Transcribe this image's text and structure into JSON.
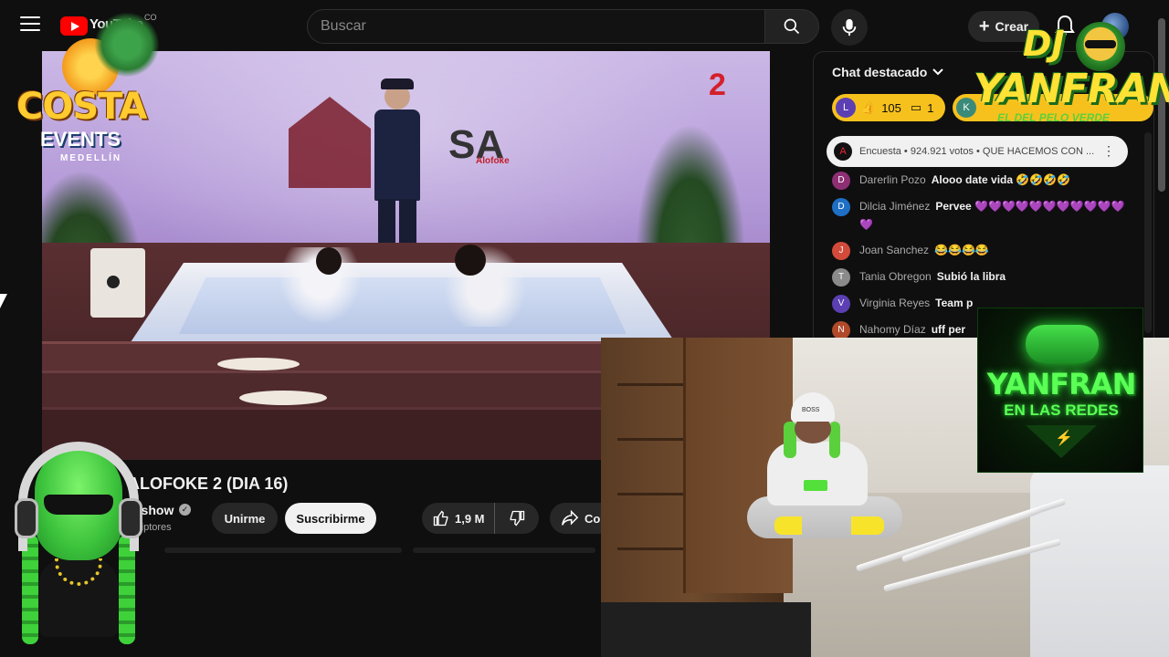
{
  "header": {
    "logo_text": "YouTube",
    "country_code": "CO",
    "search_placeholder": "Buscar",
    "create_label": "Crear"
  },
  "video": {
    "overlay_number": "2",
    "wall_logo_text": "SA",
    "wall_logo_brand": "Alofoke",
    "title": "ALOFOKE 2 (DIA 16)",
    "channel_name": "oshow",
    "subscribers": "scriptores",
    "join_label": "Unirme",
    "subscribe_label": "Suscribirme",
    "likes": "1,9 M",
    "share_label": "Co"
  },
  "chat": {
    "header": "Chat destacado",
    "pill1": {
      "avatar": "L",
      "avatar_color": "#5b3fb3",
      "likes": "105",
      "comments": "1"
    },
    "pill2": {
      "avatar": "K",
      "avatar_color": "#3a8a7a"
    },
    "poll": {
      "avatar": "A",
      "text": "Encuesta • 924.921 votos • QUE HACEMOS CON ..."
    },
    "messages": [
      {
        "avatar": "D",
        "color": "#8e2f74",
        "author": "Darerlin Pozo",
        "text": "Alooo date vida 🤣🤣🤣🤣"
      },
      {
        "avatar": "D",
        "color": "#1f6fc5",
        "author": "Dilcia Jiménez",
        "text": "Pervee 💜💜💜💜💜💜💜💜💜💜💜💜"
      },
      {
        "avatar": "J",
        "color": "#d24b3a",
        "author": "Joan Sanchez",
        "text": "😂😂😂😂"
      },
      {
        "avatar": "T",
        "color": "#8a8a8a",
        "author": "Tania Obregon",
        "text": "Subió la libra"
      },
      {
        "avatar": "V",
        "color": "#5b3fb3",
        "author": "Virginia Reyes",
        "text": "Team p"
      },
      {
        "avatar": "N",
        "color": "#b04a2a",
        "author": "Nahomy Díaz",
        "text": "uff per"
      }
    ]
  },
  "overlays": {
    "costa": {
      "word": "COSTA",
      "events": "EVENTS",
      "city": "MEDELLÍN"
    },
    "dj": {
      "prefix": "DJ",
      "name": "YANFRAN",
      "tagline": "EL DEL PELO VERDE"
    },
    "badge": {
      "name": "YANFRAN",
      "sub": "EN LAS REDES"
    },
    "cap_text": "BOSS"
  },
  "colors": {
    "background": "#0f0f0f",
    "accent_red": "#ff0000",
    "super_chat_yellow": "#f7c11d",
    "neon_green": "#5bff55"
  }
}
